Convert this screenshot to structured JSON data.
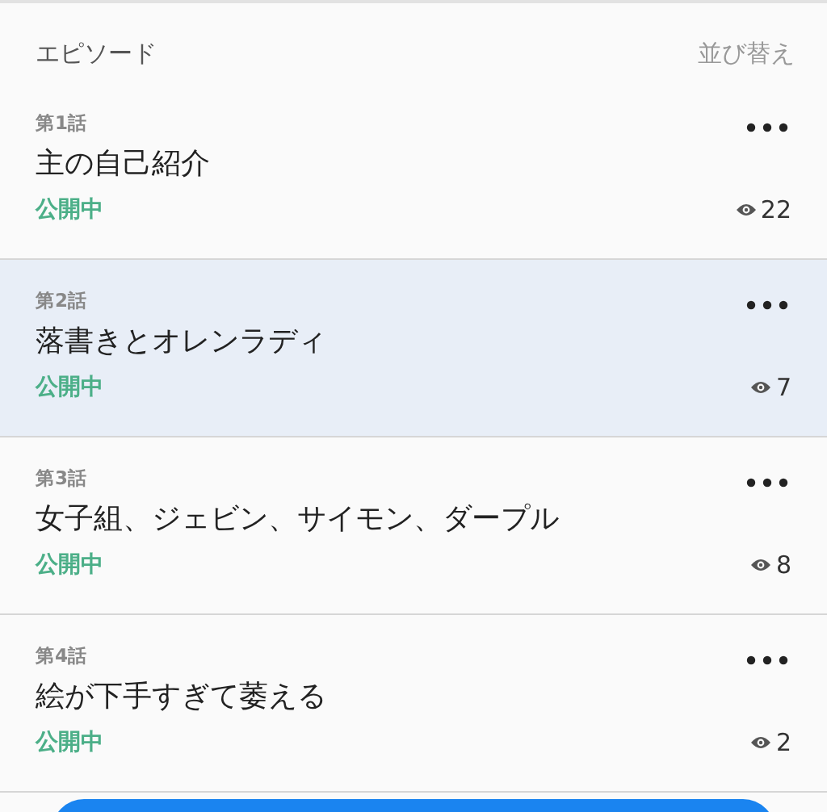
{
  "header": {
    "title": "エピソード",
    "sort_label": "並び替え"
  },
  "episodes": [
    {
      "number": "第1話",
      "title": "主の自己紹介",
      "status": "公開中",
      "views": "22",
      "selected": false
    },
    {
      "number": "第2話",
      "title": "落書きとオレンラディ",
      "status": "公開中",
      "views": "7",
      "selected": true
    },
    {
      "number": "第3話",
      "title": "女子組、ジェビン、サイモン、ダープル",
      "status": "公開中",
      "views": "8",
      "selected": false
    },
    {
      "number": "第4話",
      "title": "絵が下手すぎて萎える",
      "status": "公開中",
      "views": "2",
      "selected": false
    }
  ]
}
